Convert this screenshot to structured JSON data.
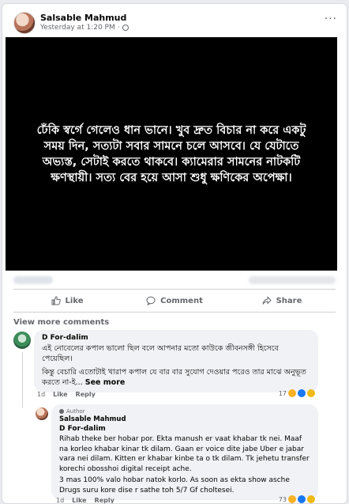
{
  "post": {
    "author": "Salsable Mahmud",
    "time": "Yesterday at 1:20 PM",
    "separator": "·",
    "more": "···",
    "image_text": "ঢেঁকি স্বর্গে গেলেও ধান ভানে। খুব দ্রুত বিচার না করে একটু সময় দিন, সত্যটা সবার সামনে চলে আসবে। যে যেটাতে অভ্যস্ত, সেটাই করতে থাকবে। ক্যামেরার সামনের নাটকটি ক্ষণস্থায়ী। সত্য বের হয়ে আসা শুধু ক্ষণিকের অপেক্ষা।"
  },
  "actions": {
    "like": "Like",
    "comment": "Comment",
    "share": "Share"
  },
  "comments": {
    "view_more": "View more comments",
    "first": {
      "name": "D For-dalim",
      "text1": "এই নোবেলের কপাল ভালো ছিল বলে আপনার মতো কাউকে জীবনসঙ্গী হিসেবে পেয়েছিল।",
      "text2": "কিন্তু বেচারি এতোটাই খারাপ কপাল যে বার বার সুযোগ দেওয়ার পরেও তার মাঝে অনুভূত করতে না-ই...",
      "see_more": "See more",
      "time": "1d",
      "like": "Like",
      "reply": "Reply",
      "reaction_count": "17"
    },
    "reply": {
      "badge": "Author",
      "name": "Salsable Mahmud",
      "mention": "D For-dalim",
      "text": "Rihab theke ber hobar por. Ekta manush er vaat khabar tk nei. Maaf na korleo khabar kinar tk dilam. Gaan er voice dite jabe Uber e jabar vara nei dilam. Kitten er khabar kinbe ta o tk dilam. Tk jehetu transfer korechi obosshoi digital receipt ache.",
      "text2": "3 mas 100% valo hobar natok korlo. As soon as ekta show asche Drugs suru kore dise r sathe toh 5/7 Gf choltesei.",
      "time": "1d",
      "like": "Like",
      "reply": "Reply",
      "reaction_count": "73"
    }
  }
}
